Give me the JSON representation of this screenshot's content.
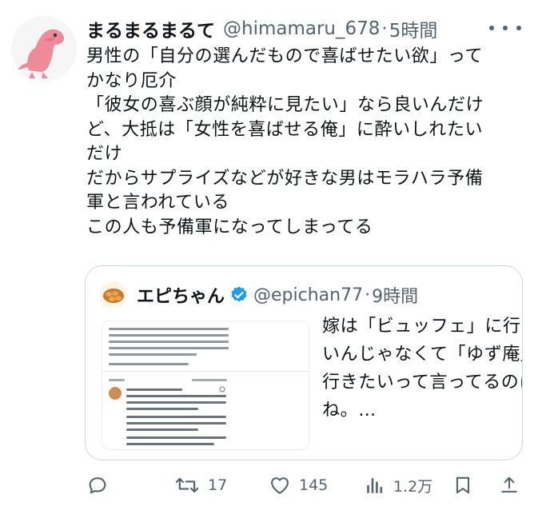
{
  "tweet": {
    "display_name": "まるまるまるて",
    "handle": "@himamaru_678",
    "separator": "·",
    "time": "5時間",
    "text_lines": [
      "男性の「自分の選んだもので喜ばせたい欲」って",
      "かなり厄介",
      "「彼女の喜ぶ顔が純粋に見たい」なら良いんだけ",
      "ど、大抵は「女性を喜ばせる俺」に酔いしれたい",
      "だけ",
      "だからサプライズなどが好きな男はモラハラ予備",
      "軍と言われている",
      "この人も予備軍になってしまってる"
    ]
  },
  "quoted": {
    "display_name": "エピちゃん",
    "handle": "@epichan77",
    "separator": "·",
    "time": "9時間",
    "text_lines": [
      "嫁は「ビュッフェ」に行きた",
      "いんじゃなくて「ゆず庵」に",
      "行きたいって言ってるのに",
      "ね。…"
    ]
  },
  "actions": {
    "reply": {
      "icon": "reply-icon"
    },
    "retweet": {
      "icon": "retweet-icon",
      "count": "17"
    },
    "like": {
      "icon": "heart-icon",
      "count": "145"
    },
    "views": {
      "icon": "views-icon",
      "count": "1.2万"
    },
    "bookmark": {
      "icon": "bookmark-icon"
    },
    "share": {
      "icon": "share-icon"
    }
  },
  "colors": {
    "text": "#0f1419",
    "muted": "#536471",
    "border": "#cfd9de",
    "verified": "#1d9bf0",
    "avatar_pink": "#ee8a9a"
  }
}
